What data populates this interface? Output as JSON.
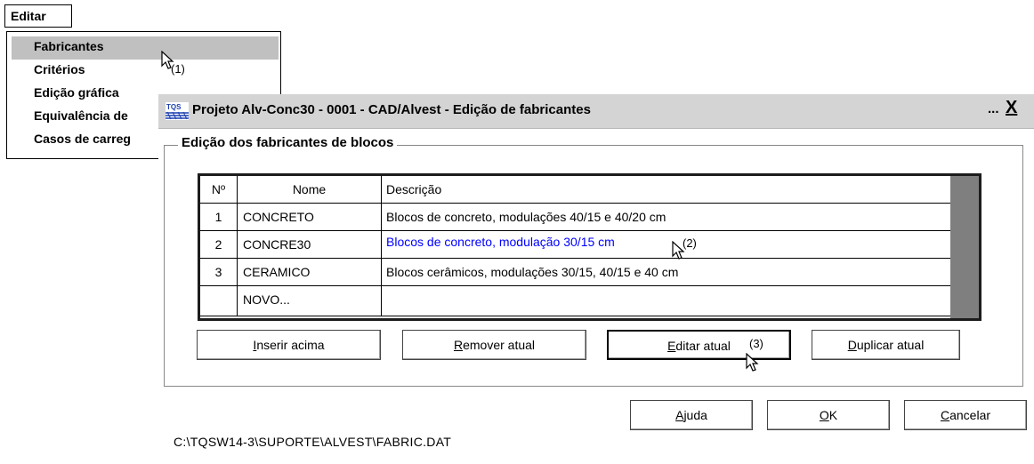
{
  "menu": {
    "label": "Editar",
    "items": [
      {
        "label": "Fabricantes",
        "highlighted": true
      },
      {
        "label": "Critérios"
      },
      {
        "label": "Edição gráfica"
      },
      {
        "label": "Equivalência de"
      },
      {
        "label": "Casos de carreg"
      }
    ]
  },
  "annotations": {
    "a1": "(1)",
    "a2": "(2)",
    "a3": "(3)"
  },
  "dialog": {
    "title": "Projeto Alv-Conc30 - 0001 - CAD/Alvest - Edição de fabricantes",
    "title_dots": "...",
    "close_label": "X",
    "group_title": "Edição dos fabricantes de blocos",
    "table": {
      "headers": [
        "Nº",
        "Nome",
        "Descrição"
      ],
      "rows": [
        {
          "num": "1",
          "name": "CONCRETO",
          "desc": "Blocos de concreto, modulações 40/15 e 40/20 cm"
        },
        {
          "num": "2",
          "name": "CONCRE30",
          "desc": "Blocos de concreto, modulação 30/15 cm"
        },
        {
          "num": "3",
          "name": "CERAMICO",
          "desc": "Blocos cerâmicos, modulações 30/15, 40/15 e 40 cm"
        },
        {
          "num": "",
          "name": "NOVO...",
          "desc": ""
        }
      ]
    },
    "buttons": {
      "insert": {
        "mnemonic": "I",
        "rest": "nserir acima"
      },
      "remove": {
        "mnemonic": "R",
        "rest": "emover atual"
      },
      "edit": {
        "mnemonic": "E",
        "rest": "ditar atual"
      },
      "duplicate": {
        "mnemonic": "D",
        "rest": "uplicar atual"
      },
      "help": {
        "mnemonic": "A",
        "rest": "juda"
      },
      "ok": {
        "mnemonic": "O",
        "rest": "K"
      },
      "cancel": {
        "mnemonic": "C",
        "rest": "ancelar"
      }
    },
    "file_path": "C:\\TQSW14-3\\SUPORTE\\ALVEST\\FABRIC.DAT"
  },
  "colors": {
    "link_blue": "#0000ff",
    "menu_highlight": "#c0c0c0",
    "titlebar": "#d4d4d4"
  }
}
